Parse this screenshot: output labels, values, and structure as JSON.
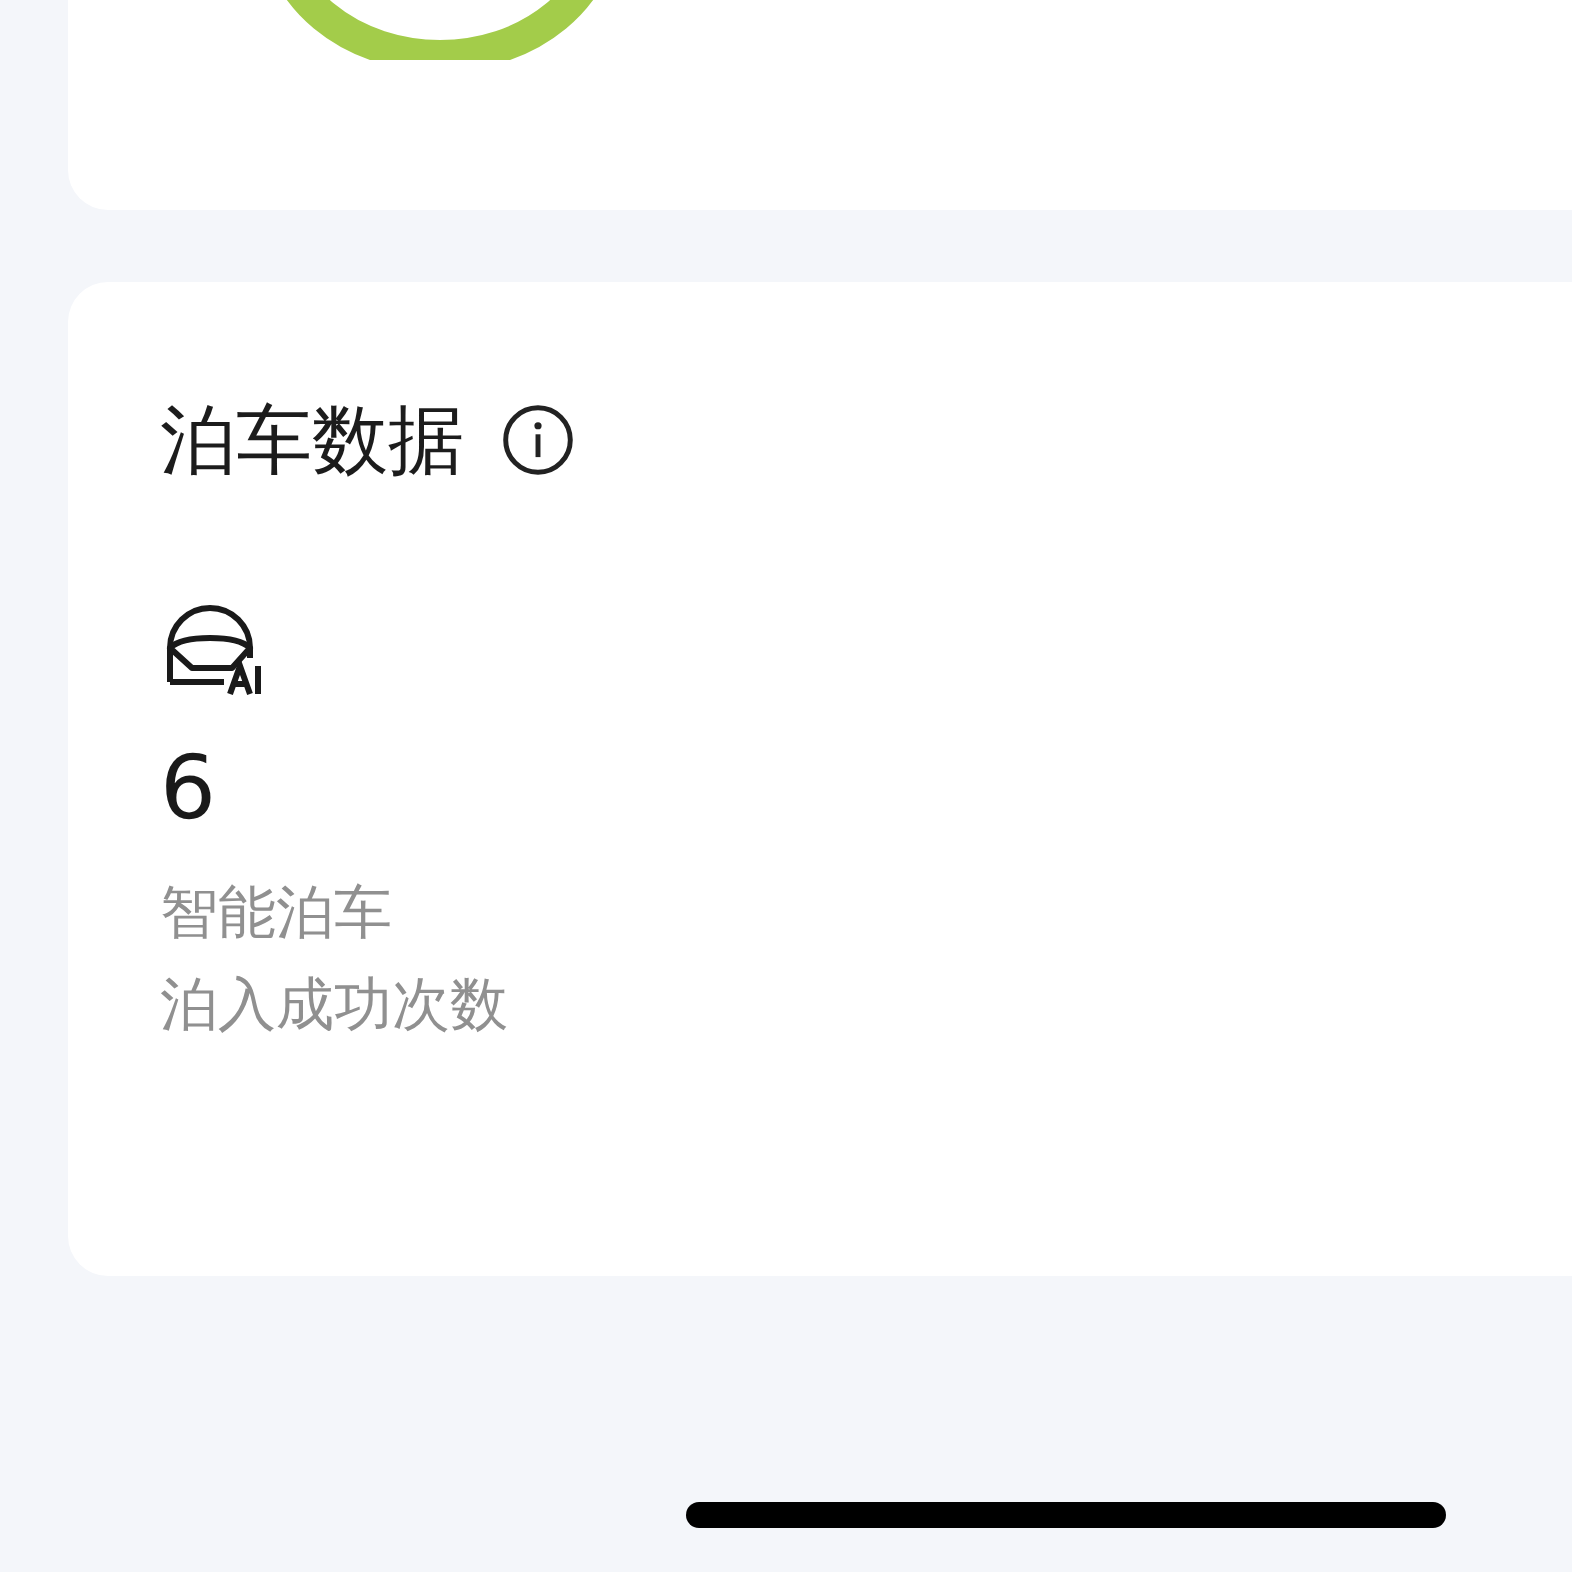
{
  "parking_data": {
    "title": "泊车数据",
    "stat": {
      "value": "6",
      "label_lines": [
        "智能泊车",
        "泊入成功次数"
      ]
    }
  }
}
